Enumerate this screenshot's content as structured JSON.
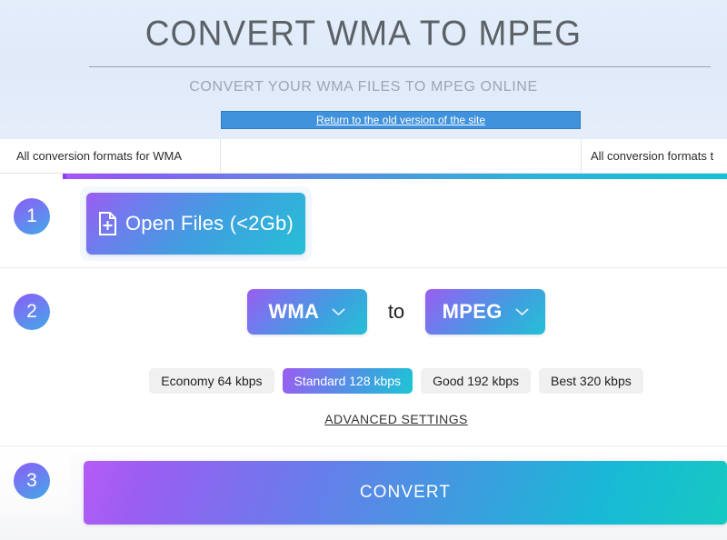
{
  "header": {
    "title": "CONVERT WMA TO MPEG",
    "subtitle": "CONVERT YOUR WMA FILES TO MPEG ONLINE",
    "old_version_link": "Return to the old version of the site"
  },
  "tabs": [
    {
      "label": "All conversion formats for WMA"
    },
    {
      "label": ""
    },
    {
      "label": "All conversion formats t"
    }
  ],
  "steps": {
    "one": {
      "number": "1",
      "open_files_label": "Open Files (<2Gb)",
      "open_files_icon": "file-plus-icon"
    },
    "two": {
      "number": "2",
      "source_format": "WMA",
      "to_word": "to",
      "target_format": "MPEG",
      "chevron_icon": "chevron-down-icon",
      "quality_presets": [
        {
          "label": "Economy 64 kbps",
          "selected": false
        },
        {
          "label": "Standard 128 kbps",
          "selected": true
        },
        {
          "label": "Good 192 kbps",
          "selected": false
        },
        {
          "label": "Best 320 kbps",
          "selected": false
        }
      ],
      "advanced_settings_label": "ADVANCED SETTINGS"
    },
    "three": {
      "number": "3",
      "convert_label": "CONVERT"
    }
  },
  "colors": {
    "accent_purple": "#8b3dfa",
    "accent_cyan": "#12c2d6",
    "link_button_blue": "#4192dc",
    "header_bg": "#e0eaf9"
  }
}
